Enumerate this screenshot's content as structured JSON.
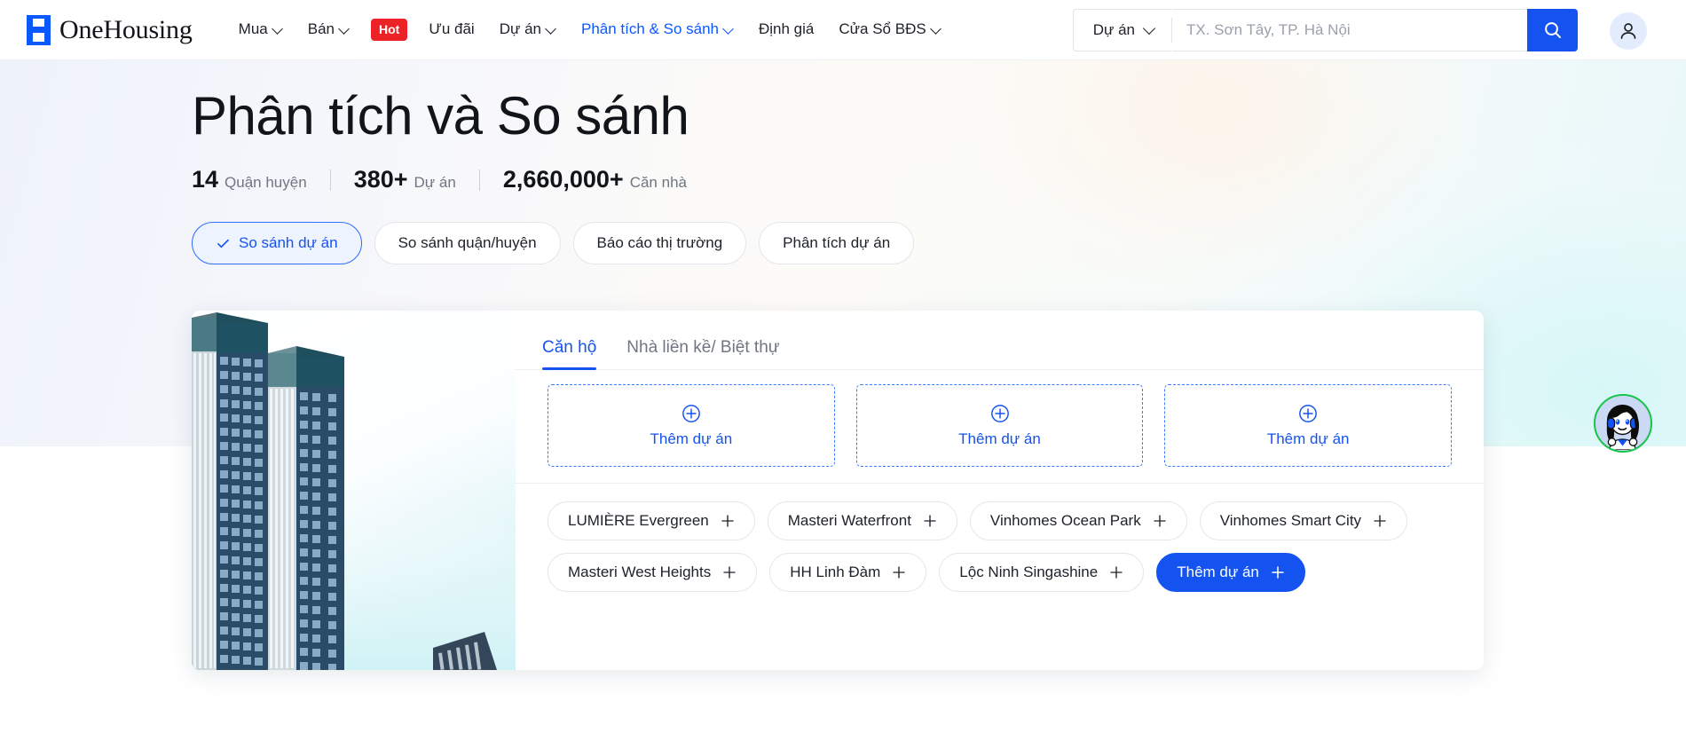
{
  "header": {
    "logo_text": "OneHousing",
    "nav": [
      {
        "label": "Mua",
        "has_chevron": true,
        "active": false
      },
      {
        "label": "Bán",
        "has_chevron": true,
        "active": false
      },
      {
        "label": "Hot",
        "badge": true,
        "active": false
      },
      {
        "label": "Ưu đãi",
        "has_chevron": false,
        "active": false
      },
      {
        "label": "Dự án",
        "has_chevron": true,
        "active": false
      },
      {
        "label": "Phân tích & So sánh",
        "has_chevron": true,
        "active": true
      },
      {
        "label": "Định giá",
        "has_chevron": false,
        "active": false
      },
      {
        "label": "Cửa Sổ BĐS",
        "has_chevron": true,
        "active": false
      }
    ],
    "search": {
      "type_label": "Dự án",
      "placeholder": "TX. Sơn Tây, TP. Hà Nội",
      "value": "",
      "search_icon": "search-icon",
      "button_color": "#1553f0"
    },
    "account_icon": "user-icon"
  },
  "hero": {
    "title": "Phân tích và So sánh",
    "stats": [
      {
        "number": "14",
        "label": "Quận huyện"
      },
      {
        "number": "380+",
        "label": "Dự án"
      },
      {
        "number": "2,660,000+",
        "label": "Căn nhà"
      }
    ],
    "pills": [
      {
        "label": "So sánh dự án",
        "active": true,
        "icon": "check-icon"
      },
      {
        "label": "So sánh quận/huyện",
        "active": false
      },
      {
        "label": "Báo cáo thị trường",
        "active": false
      },
      {
        "label": "Phân tích dự án",
        "active": false
      }
    ]
  },
  "card": {
    "illustration": "skyscraper-illustration",
    "tabs": [
      {
        "label": "Căn hộ",
        "active": true
      },
      {
        "label": "Nhà liền kề/ Biệt thự",
        "active": false
      }
    ],
    "slots": [
      {
        "label": "Thêm dự án",
        "icon": "plus-circle-icon"
      },
      {
        "label": "Thêm dự án",
        "icon": "plus-circle-icon"
      },
      {
        "label": "Thêm dự án",
        "icon": "plus-circle-icon"
      }
    ],
    "chips": [
      {
        "label": "LUMIÈRE Evergreen",
        "primary": false
      },
      {
        "label": "Masteri Waterfront",
        "primary": false
      },
      {
        "label": "Vinhomes Ocean Park",
        "primary": false
      },
      {
        "label": "Vinhomes Smart City",
        "primary": false
      },
      {
        "label": "Masteri West Heights",
        "primary": false
      },
      {
        "label": "HH Linh Đàm",
        "primary": false
      },
      {
        "label": "Lộc Ninh Singashine",
        "primary": false
      },
      {
        "label": "Thêm dự án",
        "primary": true
      }
    ]
  },
  "chatbot": {
    "icon": "chatbot-avatar-icon"
  },
  "colors": {
    "brand_blue": "#1553f0",
    "link_blue": "#0a58ff",
    "hot_red": "#ec2227",
    "chatbot_ring": "#18c44a",
    "text_primary": "#111418",
    "text_muted": "#6f7681"
  }
}
